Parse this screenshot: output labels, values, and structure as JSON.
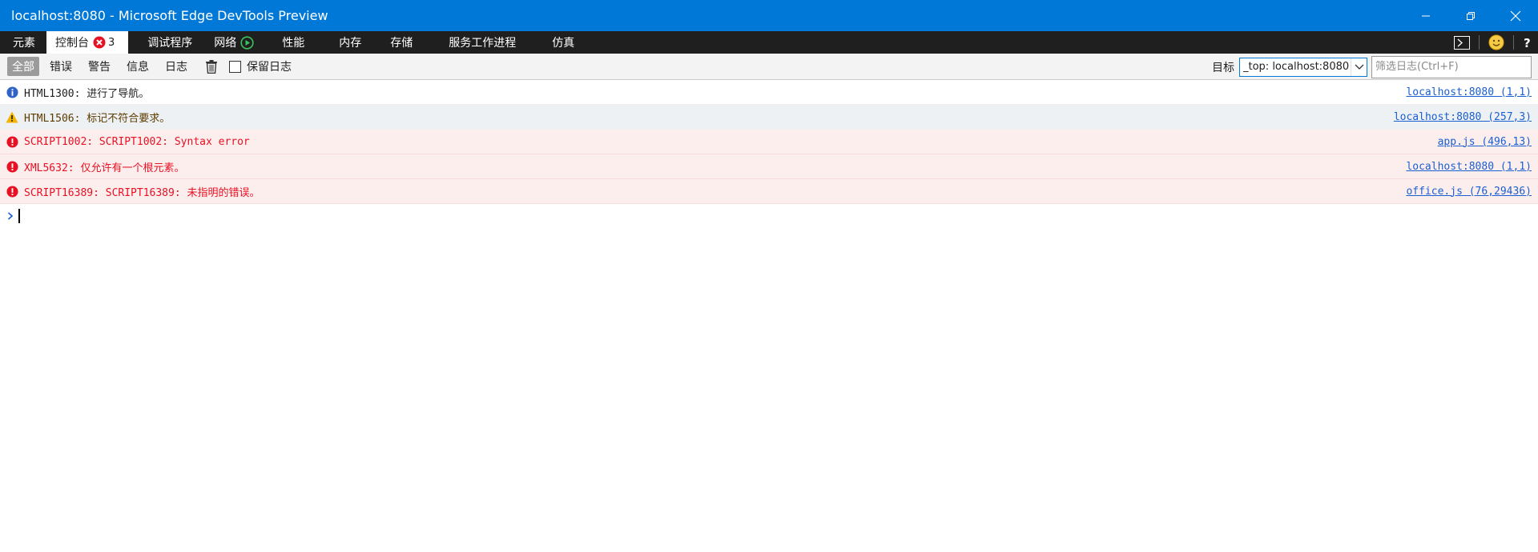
{
  "window": {
    "title": "localhost:8080 - Microsoft Edge DevTools Preview"
  },
  "tabs": [
    {
      "label": "元素"
    },
    {
      "label": "控制台",
      "badge_count": "3"
    },
    {
      "label": "调试程序"
    },
    {
      "label": "网络"
    },
    {
      "label": "性能"
    },
    {
      "label": "内存"
    },
    {
      "label": "存储"
    },
    {
      "label": "服务工作进程"
    },
    {
      "label": "仿真"
    }
  ],
  "toolbar": {
    "filters": [
      "全部",
      "错误",
      "警告",
      "信息",
      "日志"
    ],
    "preserve_log_label": "保留日志",
    "target_label": "目标",
    "target_value": "_top: localhost:8080",
    "filter_placeholder": "筛选日志(Ctrl+F)"
  },
  "messages": [
    {
      "level": "info",
      "text": "HTML1300: 进行了导航。",
      "source": "localhost:8080 (1,1)"
    },
    {
      "level": "warning",
      "text": "HTML1506: 标记不符合要求。",
      "source": "localhost:8080 (257,3)"
    },
    {
      "level": "error",
      "text": "SCRIPT1002: SCRIPT1002: Syntax error",
      "source": "app.js (496,13)"
    },
    {
      "level": "error",
      "text": "XML5632: 仅允许有一个根元素。",
      "source": "localhost:8080 (1,1)"
    },
    {
      "level": "error",
      "text": "SCRIPT16389: SCRIPT16389: 未指明的错误。",
      "source": "office.js (76,29436)"
    }
  ],
  "colors": {
    "titlebar": "#0078d7",
    "tabbar": "#1f1f1f",
    "error_text": "#e81123",
    "error_bg": "#fdeeee",
    "warning_bg": "#eef1f4",
    "link": "#1a5fd0"
  }
}
